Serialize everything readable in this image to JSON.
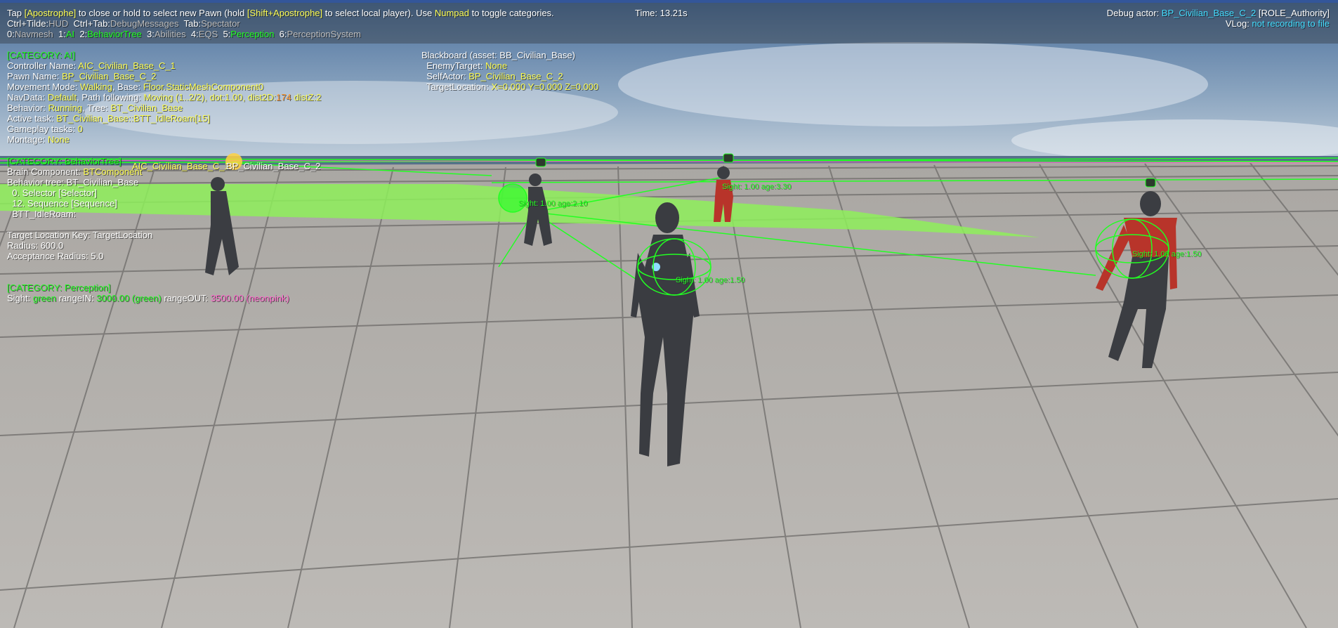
{
  "top": {
    "help_tap": "Tap ",
    "help_key1": "[Apostrophe]",
    "help_mid": " to close or hold to select new Pawn (hold ",
    "help_key2": "[Shift+Apostrophe]",
    "help_mid2": " to select local player). Use ",
    "help_key3": "Numpad",
    "help_end": " to toggle categories.",
    "time": "Time: 13.21s",
    "debug_actor_label": "Debug actor: ",
    "debug_actor_value": "BP_Civilian_Base_C_2",
    "debug_actor_role": " [ROLE_Authority]",
    "vlog_label": "VLog: ",
    "vlog_value": "not recording to file",
    "line2": [
      {
        "key": "Ctrl+Tilde:",
        "val": "HUD"
      },
      {
        "key": "Ctrl+Tab:",
        "val": "DebugMessages"
      },
      {
        "key": "Tab:",
        "val": "Spectator"
      }
    ],
    "categories": [
      {
        "num": "0:",
        "name": "Navmesh",
        "state": "off"
      },
      {
        "num": "1:",
        "name": "AI",
        "state": "on"
      },
      {
        "num": "2:",
        "name": "BehaviorTree",
        "state": "on"
      },
      {
        "num": "3:",
        "name": "Abilities",
        "state": "off"
      },
      {
        "num": "4:",
        "name": "EQS",
        "state": "off"
      },
      {
        "num": "5:",
        "name": "Perception",
        "state": "on"
      },
      {
        "num": "6:",
        "name": "PerceptionSystem",
        "state": "off"
      }
    ]
  },
  "ai": {
    "header": "[CATEGORY: AI]",
    "controller_label": "Controller Name: ",
    "controller": "AIC_Civilian_Base_C_1",
    "pawn_label": "Pawn Name: ",
    "pawn": "BP_Civilian_Base_C_2",
    "movement_label": "Movement Mode: ",
    "movement": "Walking",
    "base_label": ", Base: ",
    "base": "Floor.StaticMeshComponent0",
    "navdata_label": "NavData: ",
    "navdata": "Default",
    "path_label": ", Path following: ",
    "path": "Moving (1..2/2), dot:1.00, dist2D:",
    "dist2d": "174",
    "distz": " distZ:2",
    "behavior_label": "Behavior: ",
    "behavior": "Running",
    "tree_label": ", Tree: ",
    "tree": "BT_Civilian_Base",
    "task_label": "Active task: ",
    "task": "BT_Civilian_Base::BTT_IdleRoam[15]",
    "gameplay_label": "Gameplay tasks: ",
    "gameplay": "0",
    "montage_label": "Montage: ",
    "montage": "None"
  },
  "bt": {
    "header": "[CATEGORY: BehaviorTree]",
    "brain_label": "Brain Component: ",
    "brain": "BTComponent",
    "tree_line": "Behavior tree: BT_Civilian_Base",
    "node0": "  0. Selector [Selector]",
    "node12": "  12. Sequence [Sequence]",
    "node_task": "  BTT_IdleRoam:",
    "target_key": "Target Location Key: TargetLocation",
    "radius": "Radius: 600.0",
    "acceptance": "Acceptance Radius: 5.0"
  },
  "perception": {
    "header": "[CATEGORY: Perception]",
    "sight_label": "Sight: ",
    "sight_color": "green",
    "range_in_label": " rangeIN: ",
    "range_in": "3000.00 (green)",
    "range_out_label": " rangeOUT: ",
    "range_out": "3500.00 (neonpink)"
  },
  "blackboard": {
    "header": "Blackboard (asset: BB_Civilian_Base)",
    "enemy_label": "  EnemyTarget: ",
    "enemy": "None",
    "self_label": "  SelfActor: ",
    "self": "BP_Civilian_Base_C_2",
    "target_label": "  TargetLocation: ",
    "target": "X=0.000 Y=0.000 Z=0.000"
  },
  "world_labels": {
    "controller_tag": "AIC_Civilian_Base_C_1",
    "pawn_tag": "BP_Civilian_Base_C_2",
    "stim1": "Sight: 1.00 age:3.30",
    "stim2": "Sight: 1.00 age:2.10",
    "stim3": "Sight: 1.00 age:1.50",
    "stim4": "Sight: 1.00 age:1.50"
  },
  "colors": {
    "sky_top": "#4a6f9c",
    "sky_bottom": "#c7d3de",
    "floor": "#b4b1ad",
    "grid_line": "#6a6866",
    "debug_green": "#22ff22",
    "nav_green": "#8ef05a",
    "yellow": "#ffff55",
    "cyan": "#44ddff",
    "pink": "#ff66cc",
    "body_dark": "#3b3d42",
    "suit_red": "#b8342a"
  }
}
